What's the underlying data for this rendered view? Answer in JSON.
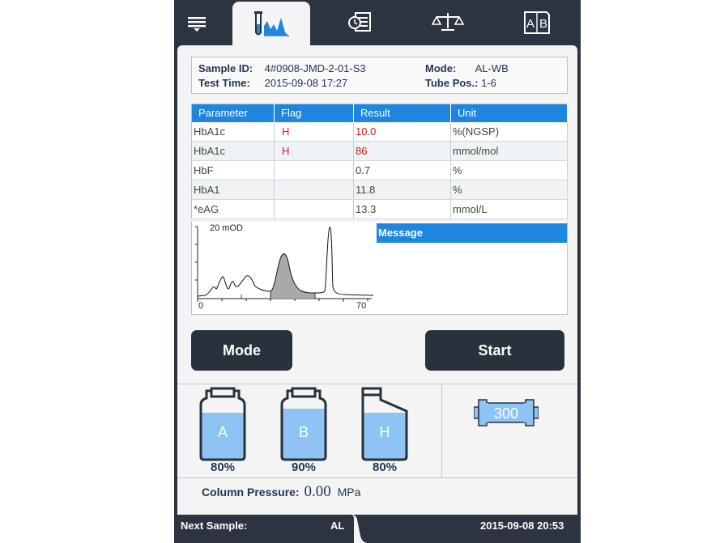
{
  "nav": {
    "tabs": [
      {
        "name": "menu",
        "icon": "menu-icon"
      },
      {
        "name": "results",
        "icon": "chromatogram-icon",
        "active": true
      },
      {
        "name": "history",
        "icon": "history-icon"
      },
      {
        "name": "calibration",
        "icon": "balance-scale-icon"
      },
      {
        "name": "compare",
        "icon": "ab-compare-icon"
      }
    ]
  },
  "sample": {
    "id_label": "Sample ID:",
    "id_value": "4#0908-JMD-2-01-S3",
    "time_label": "Test Time:",
    "time_value": "2015-09-08 17:27",
    "mode_label": "Mode:",
    "mode_value": "AL-WB",
    "tube_label": "Tube Pos.:",
    "tube_value": "1-6"
  },
  "results": {
    "headers": [
      "Parameter",
      "Flag",
      "Result",
      "Unit"
    ],
    "rows": [
      {
        "parameter": "HbA1c",
        "flag": "H",
        "result": "10.0",
        "unit": "%(NGSP)"
      },
      {
        "parameter": "HbA1c",
        "flag": "H",
        "result": "86",
        "unit": "mmol/mol"
      },
      {
        "parameter": "HbF",
        "flag": "",
        "result": "0.7",
        "unit": "%"
      },
      {
        "parameter": "HbA1",
        "flag": "",
        "result": "11.8",
        "unit": "%"
      },
      {
        "parameter": "*eAG",
        "flag": "",
        "result": "13.3",
        "unit": "mmol/L"
      }
    ],
    "flag_color": "#e0181b"
  },
  "chromatogram": {
    "ylabel": "20  mOD",
    "x_start": "0",
    "x_end": "70"
  },
  "message": {
    "title": "Message",
    "body": ""
  },
  "buttons": {
    "mode": "Mode",
    "start": "Start"
  },
  "reagents": [
    {
      "letter": "A",
      "percent": "80%",
      "level": 0.8,
      "shape": "round"
    },
    {
      "letter": "B",
      "percent": "90%",
      "level": 0.9,
      "shape": "round"
    },
    {
      "letter": "H",
      "percent": "80%",
      "level": 0.8,
      "shape": "slanted"
    }
  ],
  "pump": {
    "value": "300",
    "icon": "column-icon"
  },
  "pressure": {
    "label": "Column Pressure:",
    "value": "0.00",
    "unit": "MPa"
  },
  "status": {
    "next_label": "Next Sample:",
    "next_value": "AL",
    "datetime": "2015-09-08 20:53"
  },
  "colors": {
    "accent": "#1f86e0",
    "dark": "#28323d",
    "liquid": "#8fc3f3",
    "text_dark": "#1f3556"
  }
}
